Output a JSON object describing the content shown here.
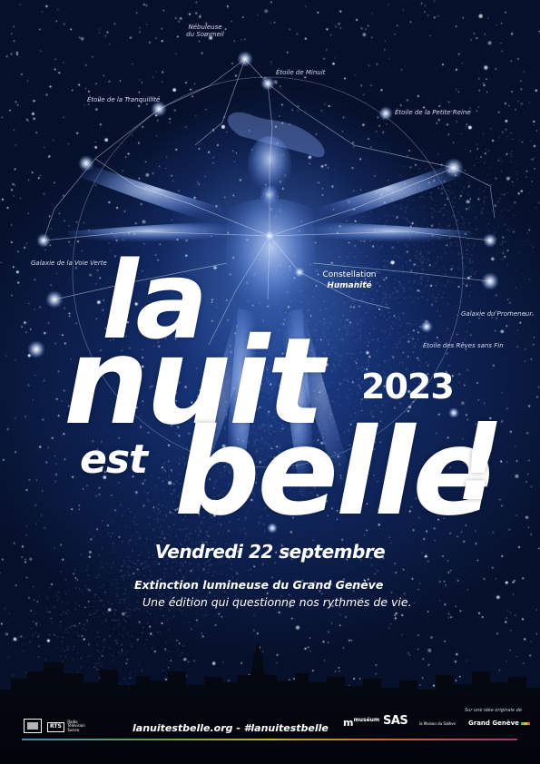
{
  "poster": {
    "title_words": {
      "la": "la",
      "nuit": "nuit",
      "est": "est",
      "belle": "belle",
      "bang": "!"
    },
    "year": "2023",
    "date": "Vendredi 22 septembre",
    "subtitle_bold": "Extinction lumineuse du Grand Genève",
    "subtitle_italic": "Une édition qui questionne nos rythmes de vie.",
    "website": "lanuitestbelle.org - #lanuitestbelle"
  },
  "constellation": {
    "name": "Constellation",
    "name_sub": "Humanité",
    "labels": {
      "nebuleuse_1": "Nébuleuse",
      "nebuleuse_2": "du Sommeil",
      "minuit": "Étoile de Minuit",
      "tranquillite": "Étoile de la Tranquillité",
      "petite_reine": "Étoile de la Petite Reine",
      "voie_verte": "Galaxie de la Voie Verte",
      "promeneur": "Galaxie du Promeneur",
      "reves": "Étoile des Rêves sans Fin"
    }
  },
  "footer": {
    "logos": {
      "rts": "RTS",
      "rts_sub": "Radio Télévision Suisse",
      "museum": "muséum",
      "sas": "SAS",
      "maison": "la Maison du Salève",
      "grand_geneve": "Grand Genève",
      "idea_credit": "Sur une idée originale de"
    }
  },
  "colors": {
    "sky_center": "#1b3d86",
    "sky_edge": "#050b1c",
    "text": "#ffffff"
  }
}
